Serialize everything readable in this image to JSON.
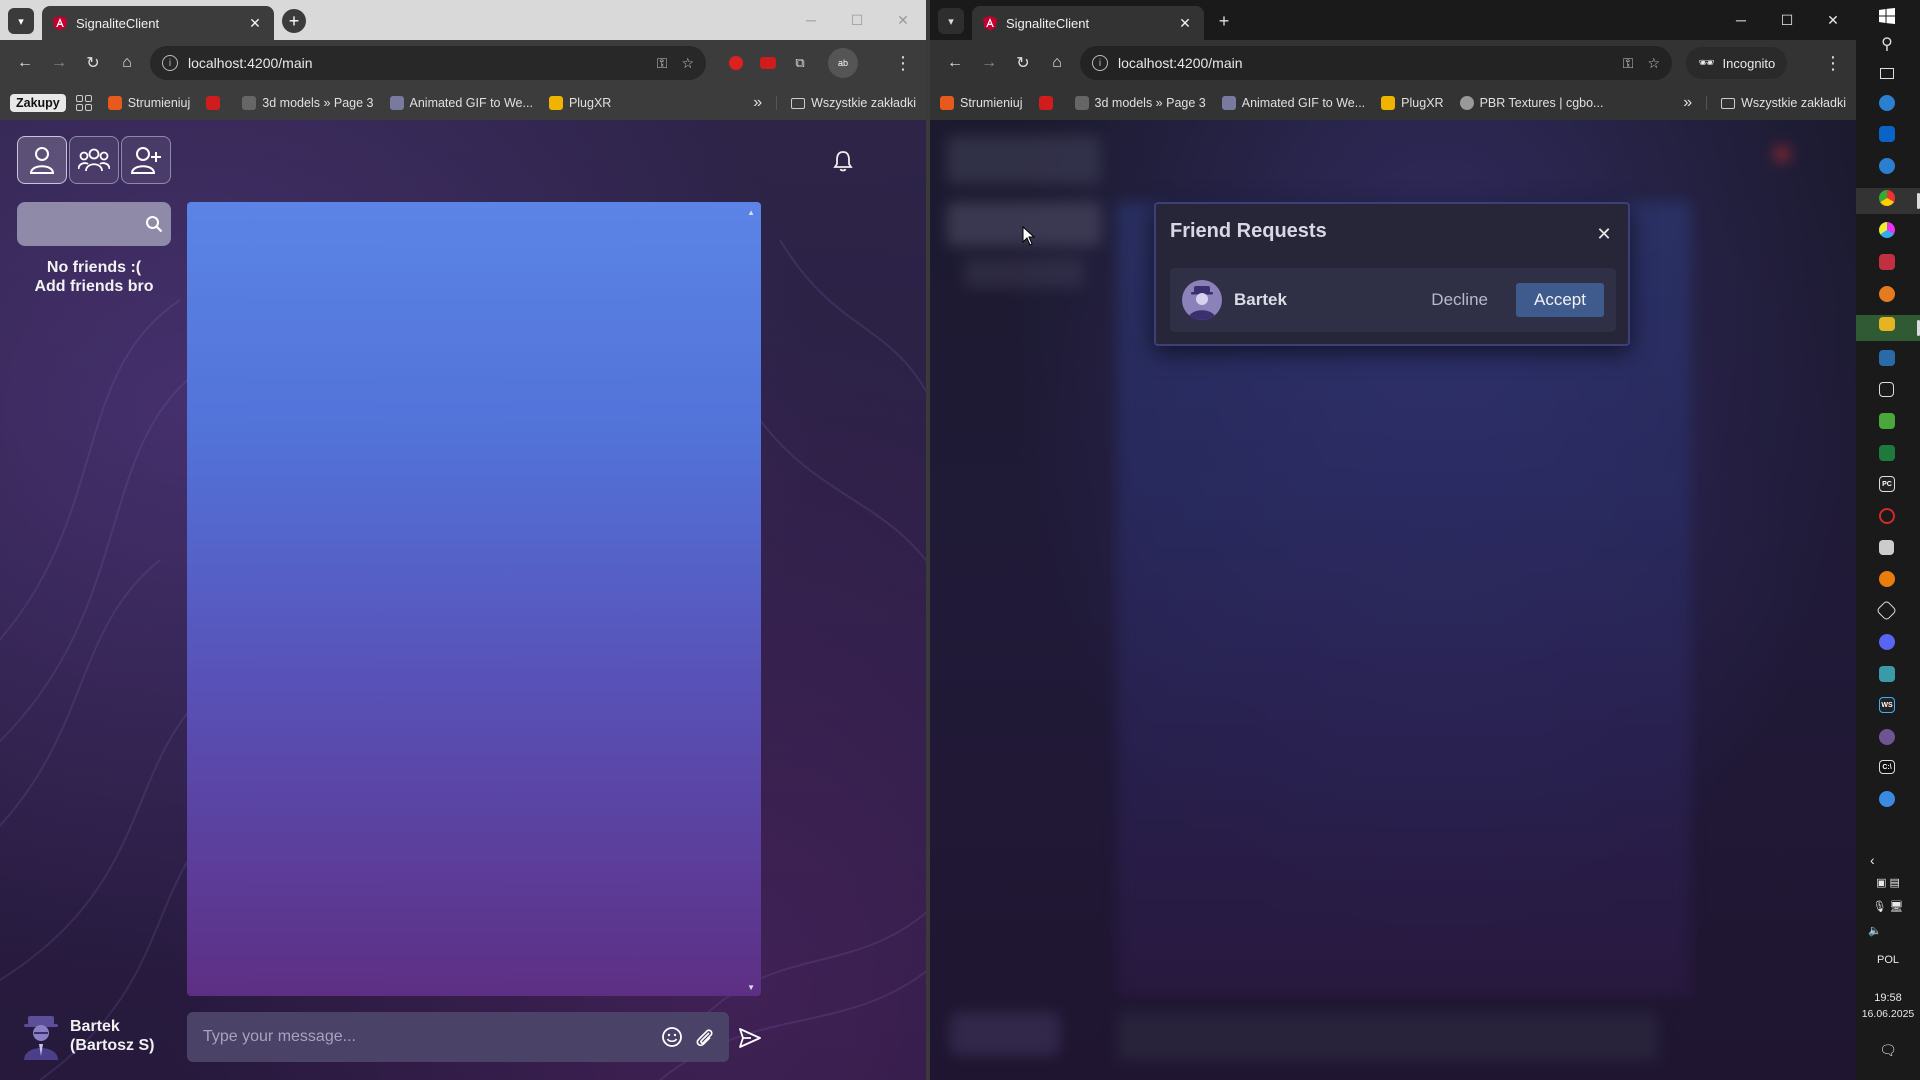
{
  "left_window": {
    "tab": {
      "title": "SignaliteClient"
    },
    "address": {
      "url": "localhost:4200/main"
    },
    "bookmarks": {
      "zakupy": "Zakupy",
      "items": [
        "Strumieniuj",
        "3d models » Page 3",
        "Animated GIF to We...",
        "PlugXR"
      ],
      "all": "Wszystkie zakładki"
    },
    "app": {
      "search_placeholder": "",
      "no_friends_line1": "No friends :(",
      "no_friends_line2": "Add friends bro",
      "message_placeholder": "Type your message...",
      "user": {
        "name": "Bartek",
        "full_name": "(Bartosz S)"
      }
    }
  },
  "right_window": {
    "tab": {
      "title": "SignaliteClient"
    },
    "address": {
      "url": "localhost:4200/main"
    },
    "incognito_label": "Incognito",
    "bookmarks": {
      "items": [
        "Strumieniuj",
        "3d models » Page 3",
        "Animated GIF to We...",
        "PlugXR",
        "PBR Textures | cgbo..."
      ],
      "all": "Wszystkie zakładki"
    },
    "modal": {
      "title": "Friend Requests",
      "request": {
        "name": "Bartek",
        "decline": "Decline",
        "accept": "Accept"
      }
    }
  },
  "taskbar": {
    "language": "POL",
    "time": "19:58",
    "date": "16.06.2025"
  },
  "colors": {
    "accent_accept": "#3f5a8c",
    "chat_gradient_top": "#5b84e6",
    "chat_gradient_bottom": "#5d2f84",
    "app_bg": "#2a1f44"
  }
}
